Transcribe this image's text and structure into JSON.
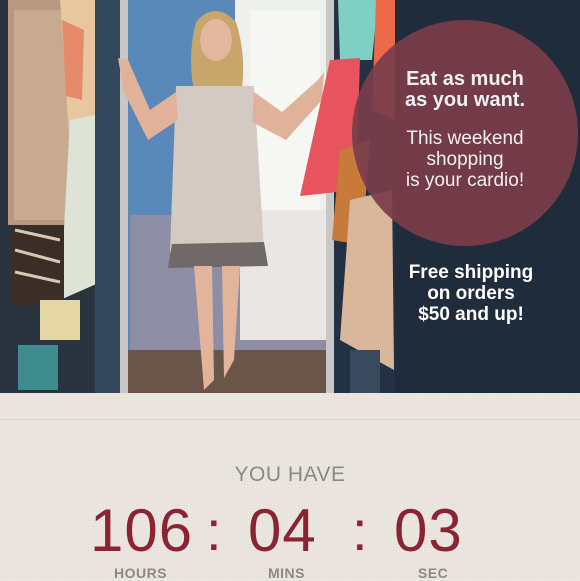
{
  "promo": {
    "headline_line1": "Eat as much",
    "headline_line2": "as you want.",
    "sub_line1": "This weekend",
    "sub_line2": "shopping",
    "sub_line3": "is your cardio!"
  },
  "shipping": {
    "line1": "Free shipping",
    "line2": "on orders",
    "line3": "$50 and up!"
  },
  "countdown": {
    "heading": "YOU HAVE",
    "hours": "106",
    "minutes": "04",
    "seconds": "03",
    "separator": ":",
    "hours_label": "HOURS",
    "minutes_label": "MINS",
    "seconds_label": "SEC"
  },
  "colors": {
    "promo_circle": "#7a3d4a",
    "timer_digits": "#8a2432",
    "labels": "#8b8886",
    "background": "#ebe6df"
  }
}
